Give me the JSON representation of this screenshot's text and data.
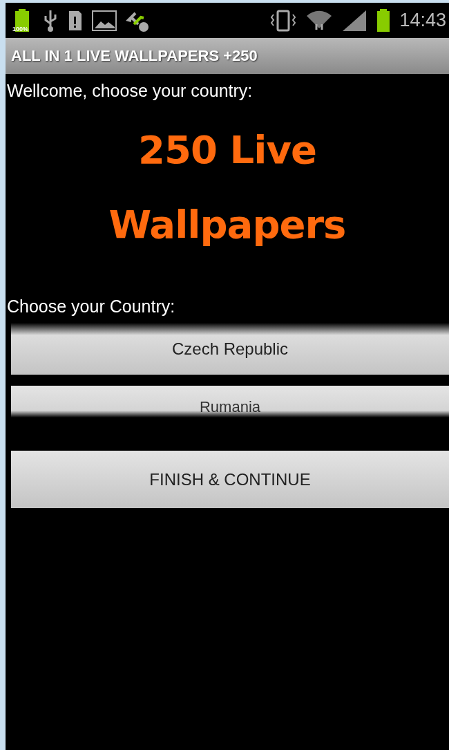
{
  "status_bar": {
    "battery_label": "100%",
    "time": "14:43"
  },
  "title": "ALL IN 1 LIVE WALLPAPERS +250",
  "welcome": "Wellcome, choose your country:",
  "logo_lines": [
    "250 Live",
    "Wallpapers"
  ],
  "choose_label": "Choose your Country:",
  "countries": [
    {
      "label": "Czech Republic",
      "faded": false
    },
    {
      "label": "Rumania",
      "faded": true
    }
  ],
  "finish_button": "FINISH & CONTINUE"
}
